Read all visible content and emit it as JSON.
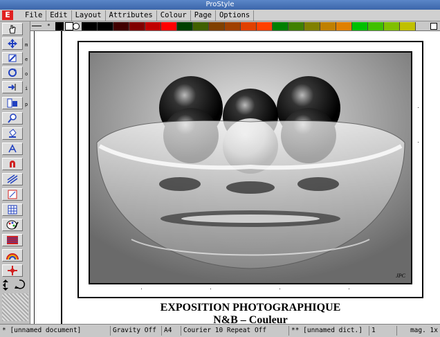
{
  "window": {
    "title": "ProStyle"
  },
  "menubar": {
    "logo": "E",
    "items": [
      "File",
      "Edit",
      "Layout",
      "Attributes",
      "Colour",
      "Page",
      "Options"
    ]
  },
  "toolbar": {
    "tools": [
      {
        "name": "hand-tool",
        "key": ""
      },
      {
        "name": "move-tool",
        "key": "m"
      },
      {
        "name": "edit-tool",
        "key": "e"
      },
      {
        "name": "rotate-tool",
        "key": "o"
      },
      {
        "name": "insert-tool",
        "key": "i"
      },
      {
        "name": "page-tool",
        "key": "p"
      },
      {
        "name": "zoom-tool",
        "key": ""
      },
      {
        "name": "fill-tool",
        "key": ""
      },
      {
        "name": "text-tool",
        "key": ""
      },
      {
        "name": "magnet-tool",
        "key": ""
      },
      {
        "name": "line-tool",
        "key": ""
      },
      {
        "name": "shape-tool",
        "key": ""
      },
      {
        "name": "grid-tool",
        "key": ""
      },
      {
        "name": "palette-tool",
        "key": ""
      },
      {
        "name": "pattern-tool",
        "key": ""
      },
      {
        "name": "rainbow-tool",
        "key": ""
      },
      {
        "name": "target-tool",
        "key": ""
      }
    ]
  },
  "palette": {
    "colors": [
      "#000000",
      "#000000",
      "#400000",
      "#800000",
      "#c00000",
      "#ff0000",
      "#004000",
      "#406000",
      "#804000",
      "#a04000",
      "#e04000",
      "#ff4000",
      "#008000",
      "#408000",
      "#808000",
      "#c08000",
      "#e08000",
      "#00c000",
      "#40c000",
      "#80c000",
      "#c0c000",
      "#ffa000",
      "#00ff00",
      "#40ff00"
    ]
  },
  "document": {
    "caption_line1": "EXPOSITION PHOTOGRAPHIQUE",
    "caption_line2": "N&B – Couleur",
    "photo_signature": "JPC"
  },
  "status": {
    "document": "* [unnamed document]",
    "gravity": "Gravity Off",
    "page_size": "A4",
    "font": "Courier 10 Repeat Off",
    "dictionary": "** [unnamed dict.]",
    "page_number": "1",
    "magnification": "mag. 1x"
  }
}
